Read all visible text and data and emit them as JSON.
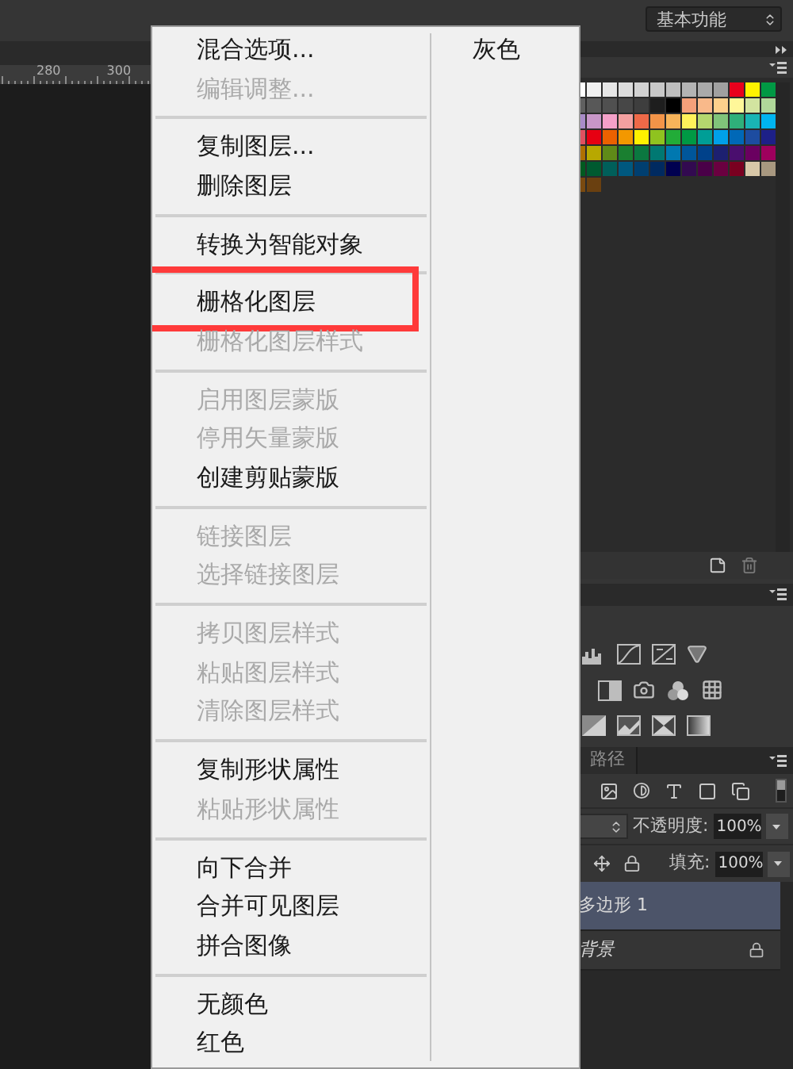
{
  "top_bar": {
    "workspace": "基本功能"
  },
  "ruler": {
    "labels": [
      "280",
      "300"
    ]
  },
  "context_menu": {
    "groups": [
      [
        {
          "label": "混合选项...",
          "disabled": false,
          "marked": false
        },
        {
          "label": "编辑调整...",
          "disabled": true,
          "marked": false
        }
      ],
      [
        {
          "label": "复制图层...",
          "disabled": false,
          "marked": false
        },
        {
          "label": "删除图层",
          "disabled": false,
          "marked": false
        }
      ],
      [
        {
          "label": "转换为智能对象",
          "disabled": false,
          "marked": false
        }
      ],
      [
        {
          "label": "栅格化图层",
          "disabled": false,
          "marked": true
        },
        {
          "label": "栅格化图层样式",
          "disabled": true,
          "marked": false
        }
      ],
      [
        {
          "label": "启用图层蒙版",
          "disabled": true,
          "marked": false
        },
        {
          "label": "停用矢量蒙版",
          "disabled": true,
          "marked": false
        },
        {
          "label": "创建剪贴蒙版",
          "disabled": false,
          "marked": false
        }
      ],
      [
        {
          "label": "链接图层",
          "disabled": true,
          "marked": false
        },
        {
          "label": "选择链接图层",
          "disabled": true,
          "marked": false
        }
      ],
      [
        {
          "label": "拷贝图层样式",
          "disabled": true,
          "marked": false
        },
        {
          "label": "粘贴图层样式",
          "disabled": true,
          "marked": false
        },
        {
          "label": "清除图层样式",
          "disabled": true,
          "marked": false
        }
      ],
      [
        {
          "label": "复制形状属性",
          "disabled": false,
          "marked": false
        },
        {
          "label": "粘贴形状属性",
          "disabled": true,
          "marked": false
        }
      ],
      [
        {
          "label": "向下合并",
          "disabled": false,
          "marked": false
        },
        {
          "label": "合并可见图层",
          "disabled": false,
          "marked": false
        },
        {
          "label": "拼合图像",
          "disabled": false,
          "marked": false
        }
      ],
      [
        {
          "label": "无颜色",
          "disabled": false,
          "marked": false
        },
        {
          "label": "红色",
          "disabled": false,
          "marked": false
        }
      ]
    ],
    "side_items": [
      {
        "label": "灰色"
      }
    ]
  },
  "swatches": {
    "rows": [
      [
        {
          "color": "#ffffff"
        },
        {
          "color": "#f0f0f0"
        },
        {
          "color": "#e6e6e6"
        },
        {
          "color": "#dcdcdc"
        },
        {
          "color": "#d2d2d2"
        },
        {
          "color": "#c8c8c8"
        },
        {
          "color": "#bebebe"
        },
        {
          "color": "#b4b4b4"
        },
        {
          "color": "#aaaaaa"
        },
        {
          "color": "#a0a0a0"
        },
        {
          "color": "#e8001c"
        },
        {
          "color": "#fff200"
        },
        {
          "color": "#009944"
        }
      ],
      [
        {
          "color": "#606060"
        },
        {
          "color": "#585858"
        },
        {
          "color": "#505050"
        },
        {
          "color": "#474747"
        },
        {
          "color": "#3e3e3e"
        },
        {
          "color": "#1e1e1e"
        },
        {
          "color": "#000000"
        },
        {
          "color": "#f5a07a"
        },
        {
          "color": "#f9b98a"
        },
        {
          "color": "#fdd08c"
        },
        {
          "color": "#fff799"
        },
        {
          "color": "#d2e4a0"
        },
        {
          "color": "#b0d89a"
        }
      ],
      [
        {
          "color": "#a98cc8"
        },
        {
          "color": "#c896c8"
        },
        {
          "color": "#f4a0c8"
        },
        {
          "color": "#f4a0a0"
        },
        {
          "color": "#ee6948"
        },
        {
          "color": "#f39448"
        },
        {
          "color": "#f7b45a"
        },
        {
          "color": "#fff15a"
        },
        {
          "color": "#b4d76e"
        },
        {
          "color": "#80c47a"
        },
        {
          "color": "#2fb07a"
        },
        {
          "color": "#19b4b4"
        },
        {
          "color": "#00b4f0"
        }
      ],
      [
        {
          "color": "#e05060"
        },
        {
          "color": "#e60012"
        },
        {
          "color": "#eb6100"
        },
        {
          "color": "#f39800"
        },
        {
          "color": "#fff100"
        },
        {
          "color": "#8fc31f"
        },
        {
          "color": "#22ac38"
        },
        {
          "color": "#009944"
        },
        {
          "color": "#009e96"
        },
        {
          "color": "#00a0e9"
        },
        {
          "color": "#0068b7"
        },
        {
          "color": "#1d4ca0"
        },
        {
          "color": "#1d2088"
        }
      ],
      [
        {
          "color": "#b07000"
        },
        {
          "color": "#b8a800"
        },
        {
          "color": "#5f8a18"
        },
        {
          "color": "#1a7f30"
        },
        {
          "color": "#0b7840"
        },
        {
          "color": "#007872"
        },
        {
          "color": "#0078b0"
        },
        {
          "color": "#00569a"
        },
        {
          "color": "#00418a"
        },
        {
          "color": "#1d2070"
        },
        {
          "color": "#4a0e6e"
        },
        {
          "color": "#6a0060"
        },
        {
          "color": "#9e005d"
        }
      ],
      [
        {
          "color": "#005a20"
        },
        {
          "color": "#005a30"
        },
        {
          "color": "#005f5a"
        },
        {
          "color": "#00587f"
        },
        {
          "color": "#003f70"
        },
        {
          "color": "#002a60"
        },
        {
          "color": "#000050"
        },
        {
          "color": "#320a50"
        },
        {
          "color": "#4a0048"
        },
        {
          "color": "#6a0040"
        },
        {
          "color": "#7a0020"
        },
        {
          "color": "#d8c8a8"
        },
        {
          "color": "#a89880"
        }
      ],
      [
        {
          "color": "#7a4a10"
        },
        {
          "color": "#6a4010"
        }
      ]
    ]
  },
  "layers_panel": {
    "tabs": [
      {
        "label": "路径",
        "selected": false
      }
    ],
    "opacity_label": "不透明度:",
    "opacity": "100%",
    "fill_label": "填充:",
    "fill": "100%",
    "layers": [
      {
        "name": "多边形 1",
        "selected": true,
        "locked": false
      },
      {
        "name": "背景",
        "selected": false,
        "locked": true
      }
    ]
  }
}
